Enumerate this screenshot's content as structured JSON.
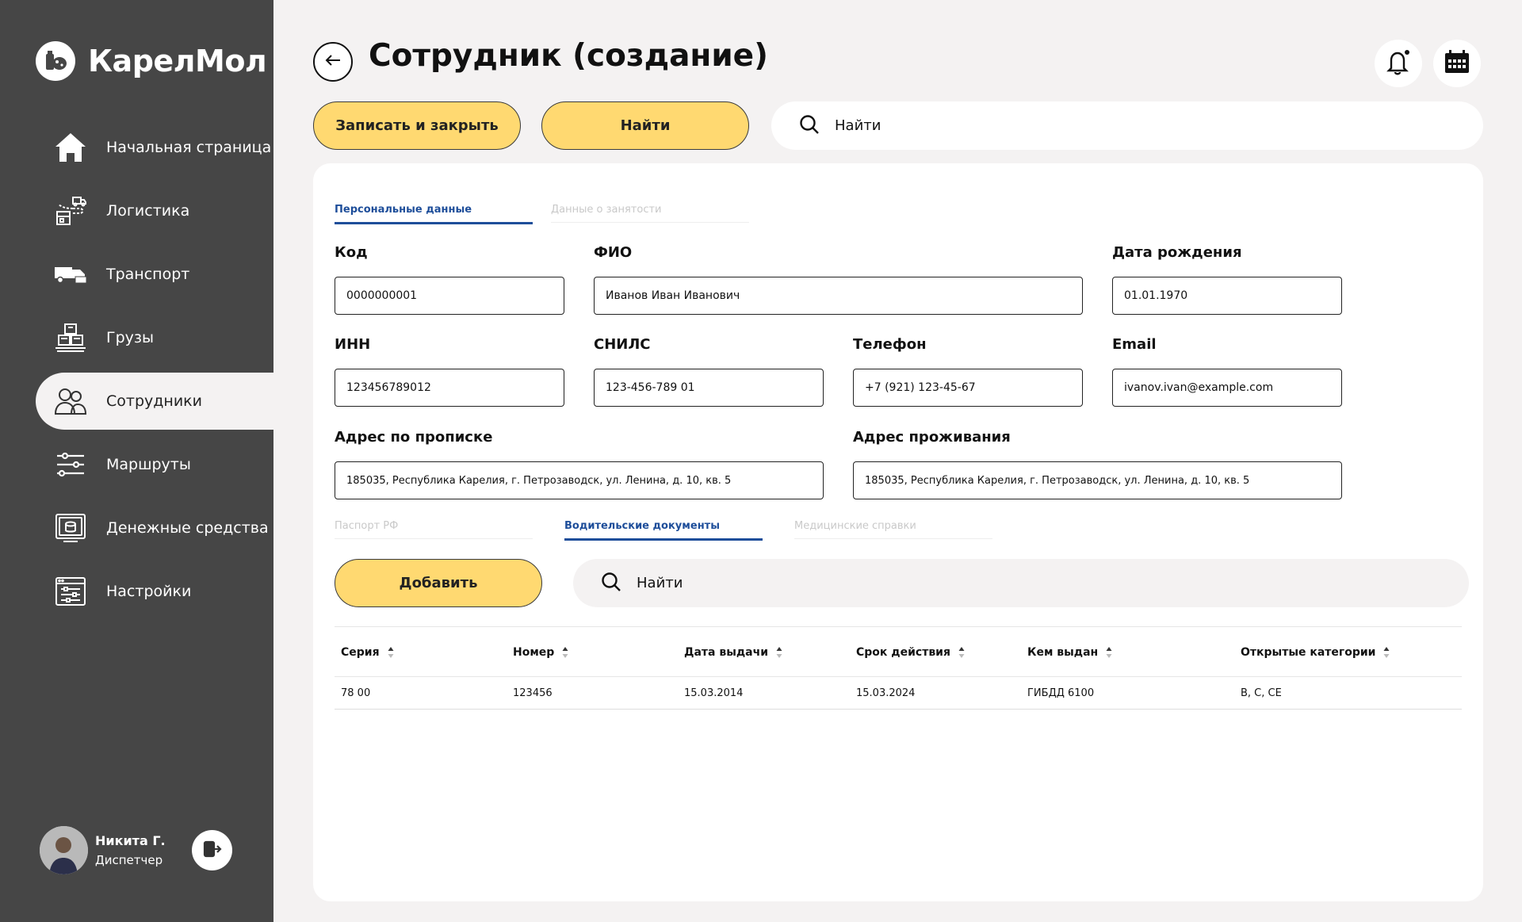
{
  "app": {
    "name": "КарелМол",
    "icon": "milk-logo-icon"
  },
  "sidebar": {
    "items": [
      {
        "label": "Начальная страница",
        "icon": "home-icon",
        "active": false
      },
      {
        "label": "Логистика",
        "icon": "logistics-icon",
        "active": false
      },
      {
        "label": "Транспорт",
        "icon": "truck-icon",
        "active": false
      },
      {
        "label": "Грузы",
        "icon": "cargo-icon",
        "active": false
      },
      {
        "label": "Сотрудники",
        "icon": "employees-icon",
        "active": true
      },
      {
        "label": "Маршруты",
        "icon": "routes-icon",
        "active": false
      },
      {
        "label": "Денежные средства",
        "icon": "money-icon",
        "active": false
      },
      {
        "label": "Настройки",
        "icon": "settings-icon",
        "active": false
      }
    ]
  },
  "user": {
    "name": "Никита Г.",
    "role": "Диспетчер"
  },
  "header": {
    "title": "Сотрудник (создание)",
    "save_close_label": "Записать и закрыть",
    "find_label": "Найти",
    "search_value": "Найти"
  },
  "tabs": {
    "main": [
      {
        "label": "Персональные данные",
        "active": true
      },
      {
        "label": "Данные о занятости",
        "active": false
      }
    ],
    "docs": [
      {
        "label": "Паспорт РФ",
        "active": false
      },
      {
        "label": "Водительские документы",
        "active": true
      },
      {
        "label": "Медицинские справки",
        "active": false
      }
    ]
  },
  "form": {
    "code": {
      "label": "Код",
      "value": "0000000001"
    },
    "fio": {
      "label": "ФИО",
      "value": "Иванов Иван Иванович"
    },
    "birth_date": {
      "label": "Дата рождения",
      "value": "01.01.1970"
    },
    "inn": {
      "label": "ИНН",
      "value": "123456789012"
    },
    "snils": {
      "label": "СНИЛС",
      "value": "123-456-789 01"
    },
    "phone": {
      "label": "Телефон",
      "value": "+7 (921) 123-45-67"
    },
    "email": {
      "label": "Email",
      "value": "ivanov.ivan@example.com"
    },
    "reg_address": {
      "label": "Адрес по прописке",
      "value": "185035, Республика Карелия, г. Петрозаводск, ул. Ленина, д. 10, кв. 5"
    },
    "live_address": {
      "label": "Адрес проживания",
      "value": "185035, Республика Карелия, г. Петрозаводск, ул. Ленина, д. 10, кв. 5"
    }
  },
  "docs_panel": {
    "add_label": "Добавить",
    "search_value": "Найти"
  },
  "table": {
    "columns": [
      "Серия",
      "Номер",
      "Дата выдачи",
      "Срок действия",
      "Кем выдан",
      "Открытые категории"
    ],
    "rows": [
      [
        "78 00",
        "123456",
        "15.03.2014",
        "15.03.2024",
        "ГИБДД 6100",
        "B, C, CE"
      ]
    ]
  },
  "colors": {
    "sidebar_bg": "#464646",
    "accent_yellow": "#ffd971",
    "active_tab_blue": "#1e4e9a",
    "page_bg": "#f4f2f2"
  }
}
